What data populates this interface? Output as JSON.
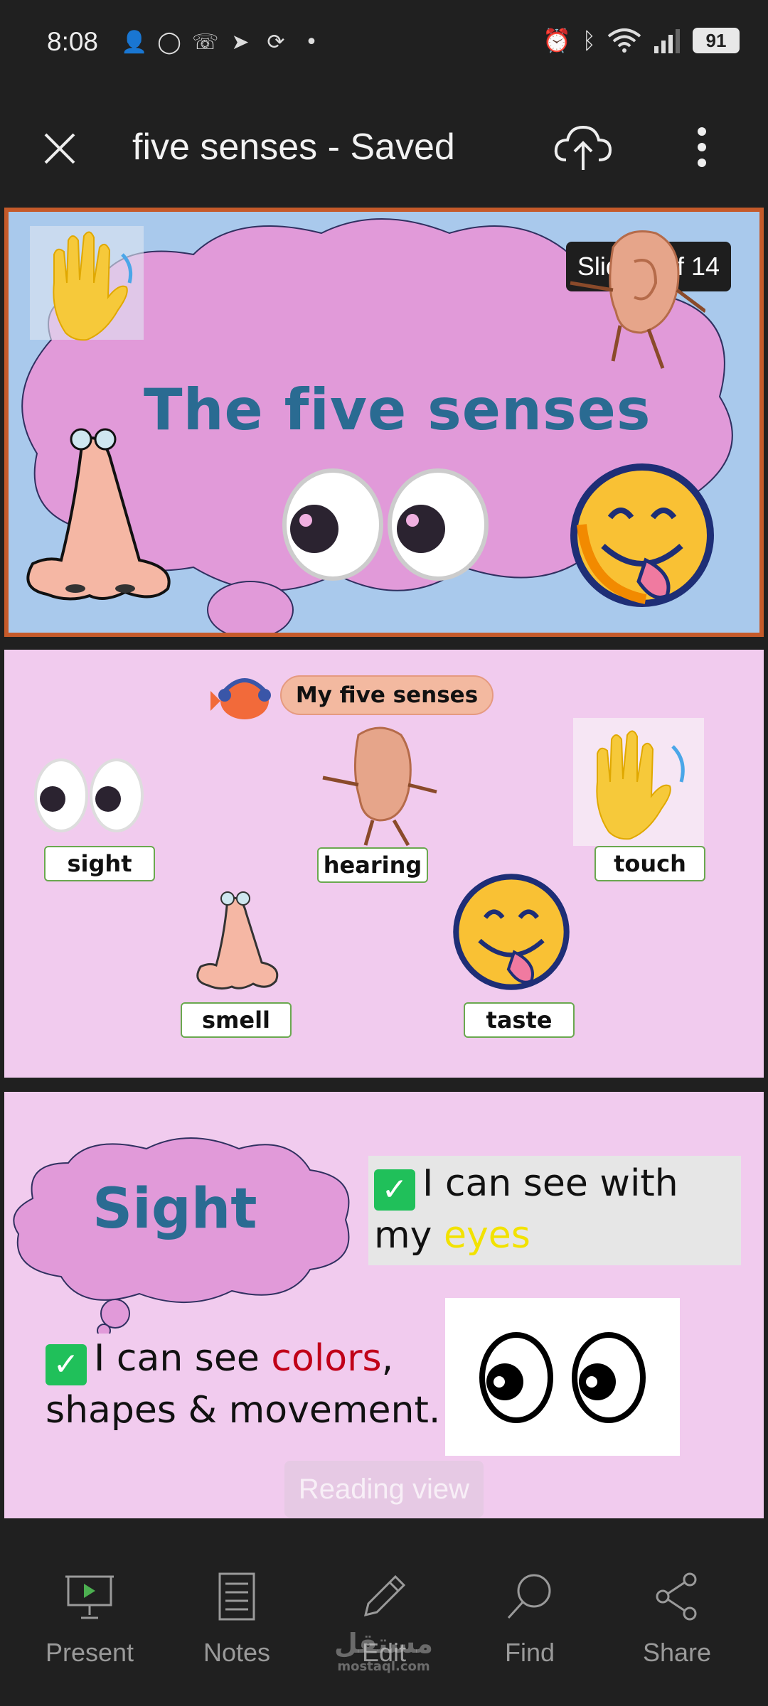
{
  "status_bar": {
    "time": "8:08",
    "battery": "91",
    "notification_icons": [
      "person-add-icon",
      "whatsapp-icon",
      "missed-call-icon",
      "telegram-icon",
      "sync-icon",
      "dot-icon"
    ],
    "system_icons": [
      "alarm-icon",
      "bluetooth-icon",
      "wifi-icon",
      "signal-icon"
    ]
  },
  "app_bar": {
    "title": "five senses - Saved"
  },
  "slide1": {
    "badge": "Slide 1 of 14",
    "title": "The five senses"
  },
  "slide2": {
    "heading": "My five senses",
    "labels": {
      "sight": "sight",
      "hearing": "hearing",
      "touch": "touch",
      "smell": "smell",
      "taste": "taste"
    }
  },
  "slide3": {
    "cloud_title": "Sight",
    "line1_a": "I can see with my ",
    "line1_b": "eyes",
    "line2_a": "I can see ",
    "line2_b": "colors",
    "line2_c": ", shapes & movement.",
    "image_caption": "googly eye animation"
  },
  "overlay": {
    "reading_view": "Reading view"
  },
  "bottom_nav": {
    "present": "Present",
    "notes": "Notes",
    "edit": "Edit",
    "find": "Find",
    "share": "Share"
  },
  "watermark": {
    "arabic": "مستقل",
    "latin": "mostaql.com"
  },
  "colors": {
    "accent_border": "#c55a2a",
    "title_blue": "#2a6b92",
    "check_green": "#20c05a"
  }
}
